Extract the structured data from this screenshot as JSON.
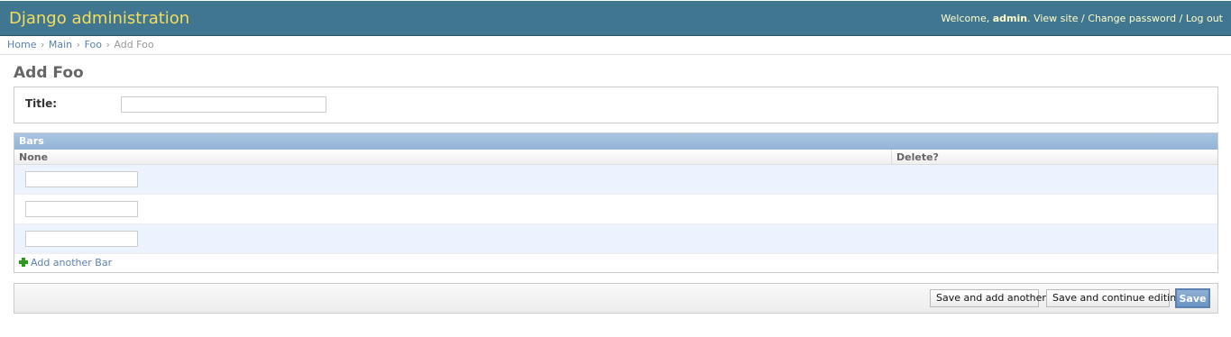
{
  "header": {
    "site_title": "Django administration",
    "welcome_prefix": "Welcome, ",
    "username": "admin",
    "welcome_suffix": ".",
    "view_site": "View site",
    "change_password": "Change password",
    "log_out": "Log out",
    "separator": "/",
    "colors": {
      "background": "#417690",
      "title": "#f5dd5d",
      "user_tools": "#ffffcc"
    }
  },
  "breadcrumbs": {
    "items": [
      "Home",
      "Main",
      "Foo"
    ],
    "current": "Add Foo",
    "separator": "›"
  },
  "page": {
    "title": "Add Foo"
  },
  "form": {
    "title_label": "Title:",
    "title_value": ""
  },
  "inline": {
    "header": "Bars",
    "columns": [
      "None",
      "Delete?"
    ],
    "rows": [
      {
        "value": ""
      },
      {
        "value": ""
      },
      {
        "value": ""
      }
    ],
    "add_another": "Add another Bar",
    "add_icon": "plus-icon"
  },
  "submit": {
    "save_and_add_another": "Save and add another",
    "save_and_continue": "Save and continue editing",
    "save": "Save",
    "accent": "#5b80b2"
  }
}
